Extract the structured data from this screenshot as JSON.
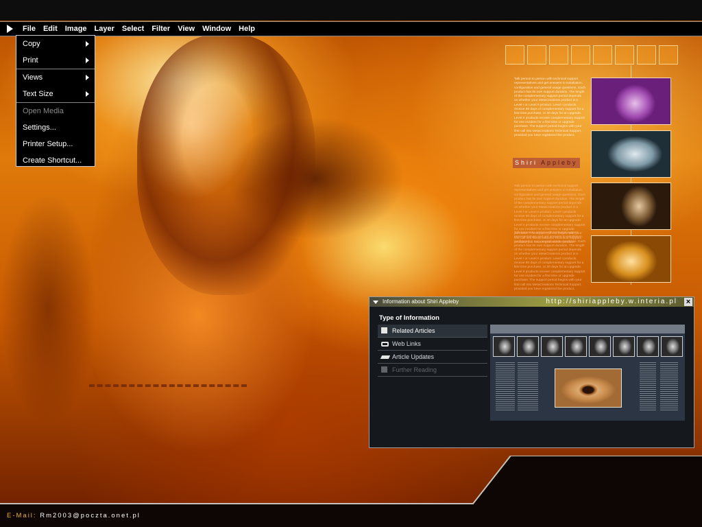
{
  "menubar": {
    "items": [
      "File",
      "Edit",
      "Image",
      "Layer",
      "Select",
      "Filter",
      "View",
      "Window",
      "Help"
    ]
  },
  "dropdown": {
    "items": [
      {
        "label": "Copy",
        "submenu": true,
        "enabled": true
      },
      {
        "label": "Print",
        "submenu": true,
        "enabled": true
      },
      {
        "label": "Views",
        "submenu": true,
        "enabled": true
      },
      {
        "label": "Text Size",
        "submenu": true,
        "enabled": true
      },
      {
        "label": "Open Media",
        "submenu": false,
        "enabled": false
      },
      {
        "label": "Settings...",
        "submenu": false,
        "enabled": true
      },
      {
        "label": "Printer Setup...",
        "submenu": false,
        "enabled": true
      },
      {
        "label": "Create Shortcut...",
        "submenu": false,
        "enabled": true
      }
    ]
  },
  "gallery": {
    "name_first": "Shiri",
    "name_last": "Appleby",
    "text1": "Talk person to person with technical support representatives and get answers to installation, configuration and general usage questions. Each product has its own support duration. The length of the complementary support period depends on whether your MetaCreations product is a Level I or Level II product. Level I products receive 90 days of complementary support for a first time purchase, or 30 days for an upgrade. Level II products receive complementary support for one incident for a first time or upgrade purchase. The support period begins with your first call into MetaCreations Technical Support, provided you have registered the product.",
    "text2": "Talk person to person with technical support representatives and get answers to installation, configuration and general usage questions. Each product has its own support duration. The length of the complementary support period depends on whether your MetaCreations product is a Level I or Level II product. Level I products receive 90 days of complementary support for a first time purchase, or 30 days for an upgrade. Level II products receive complementary support for one incident for a first time or upgrade purchase. The support period begins with your first call into MetaCreations Technical Support, provided you have registered the product.",
    "text3": "Talk person to person with technical support representatives and get answers to installation, configuration and general usage questions. Each product has its own support duration. The length of the complementary support period depends on whether your MetaCreations product is a Level I or Level II product. Level I products receive 90 days of complementary support for a first time purchase, or 30 days for an upgrade. Level II products receive complementary support for one incident for a first time or upgrade purchase. The support period begins with your first call into MetaCreations Technical Support, provided you have registered the product."
  },
  "panel": {
    "title": "Information about Shiri Appleby",
    "url": "http://shiriappleby.w.interia.pl",
    "close": "×",
    "section_title": "Type of Information",
    "nav": [
      {
        "label": "Related Articles",
        "icon": "document-icon",
        "active": true,
        "enabled": true
      },
      {
        "label": "Web Links",
        "icon": "link-icon",
        "active": false,
        "enabled": true
      },
      {
        "label": "Article Updates",
        "icon": "eraser-icon",
        "active": false,
        "enabled": true
      },
      {
        "label": "Further Reading",
        "icon": "document-icon",
        "active": false,
        "enabled": false
      }
    ]
  },
  "footer": {
    "email_label": "E-Mail:",
    "email_address": "Rm2003@poczta.onet.pl"
  },
  "colors": {
    "accent_orange": "#e07a0a",
    "panel_bg": "#15181d",
    "email_label": "#e8b040"
  }
}
